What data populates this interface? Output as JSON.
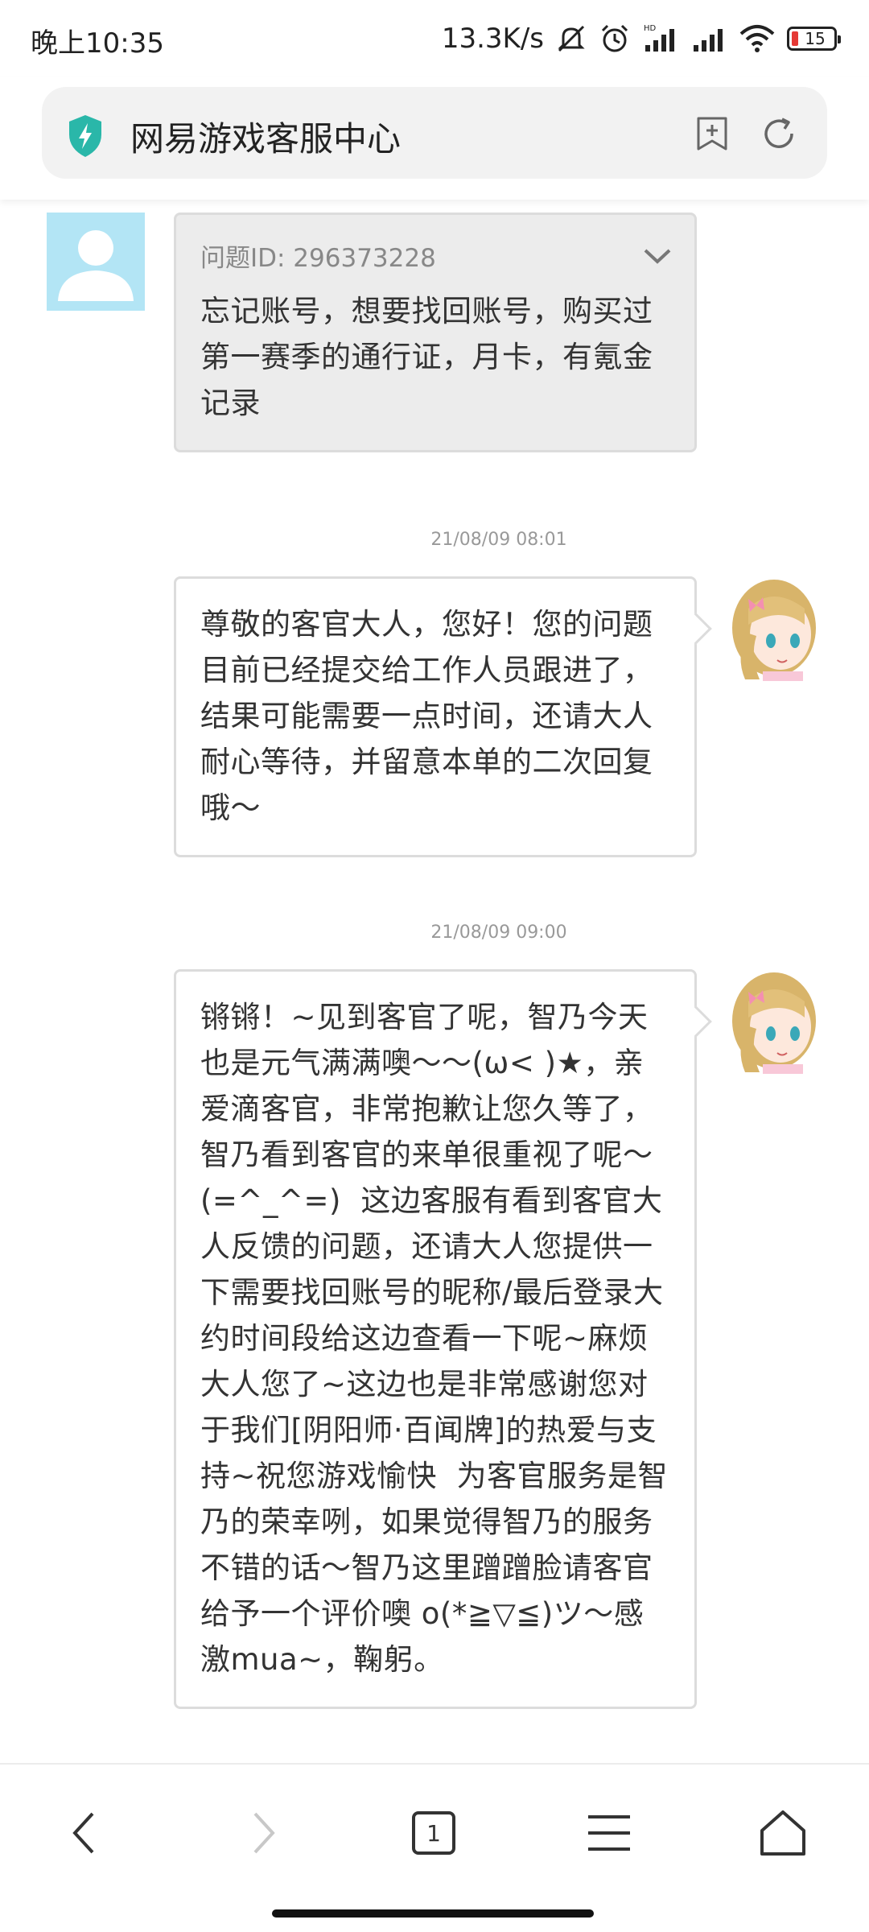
{
  "status_bar": {
    "time": "晚上10:35",
    "net_speed": "13.3K/s",
    "battery_level": "15",
    "icons": [
      "mute-icon",
      "alarm-icon",
      "hd-signal-icon",
      "signal-icon",
      "wifi-icon",
      "battery-icon"
    ]
  },
  "address_bar": {
    "title": "网易游戏客服中心",
    "icons": [
      "shield-icon",
      "add-bookmark-icon",
      "refresh-icon"
    ],
    "accent_color": "#2ab7a9"
  },
  "messages": [
    {
      "sender": "user",
      "issue_id": "问题ID: 296373228",
      "text": "忘记账号，想要找回账号，购买过第一赛季的通行证，月卡，有氪金记录"
    },
    {
      "sender": "agent",
      "timestamp": "21/08/09 08:01",
      "text": "尊敬的客官大人，您好！您的问题目前已经提交给工作人员跟进了，结果可能需要一点时间，还请大人耐心等待，并留意本单的二次回复哦～"
    },
    {
      "sender": "agent",
      "timestamp": "21/08/09 09:00",
      "text": "锵锵！~见到客官了呢，智乃今天也是元气满满噢～～(ω< )★，亲爱滴客官，非常抱歉让您久等了，智乃看到客官的来单很重视了呢～(=^_^=)  这边客服有看到客官大人反馈的问题，还请大人您提供一下需要找回账号的昵称/最后登录大约时间段给这边查看一下呢~麻烦大人您了~这边也是非常感谢您对于我们[阴阳师·百闻牌]的热爱与支持~祝您游戏愉快  为客官服务是智乃的荣幸咧，如果觉得智乃的服务不错的话～智乃这里蹭蹭脸请客官给予一个评价噢 o(*≧▽≦)ツ～感激mua~，鞠躬。"
    }
  ],
  "bottom_nav": {
    "tab_count": "1",
    "icons": [
      "back-icon",
      "forward-icon",
      "tabs-icon",
      "menu-icon",
      "home-icon"
    ]
  }
}
